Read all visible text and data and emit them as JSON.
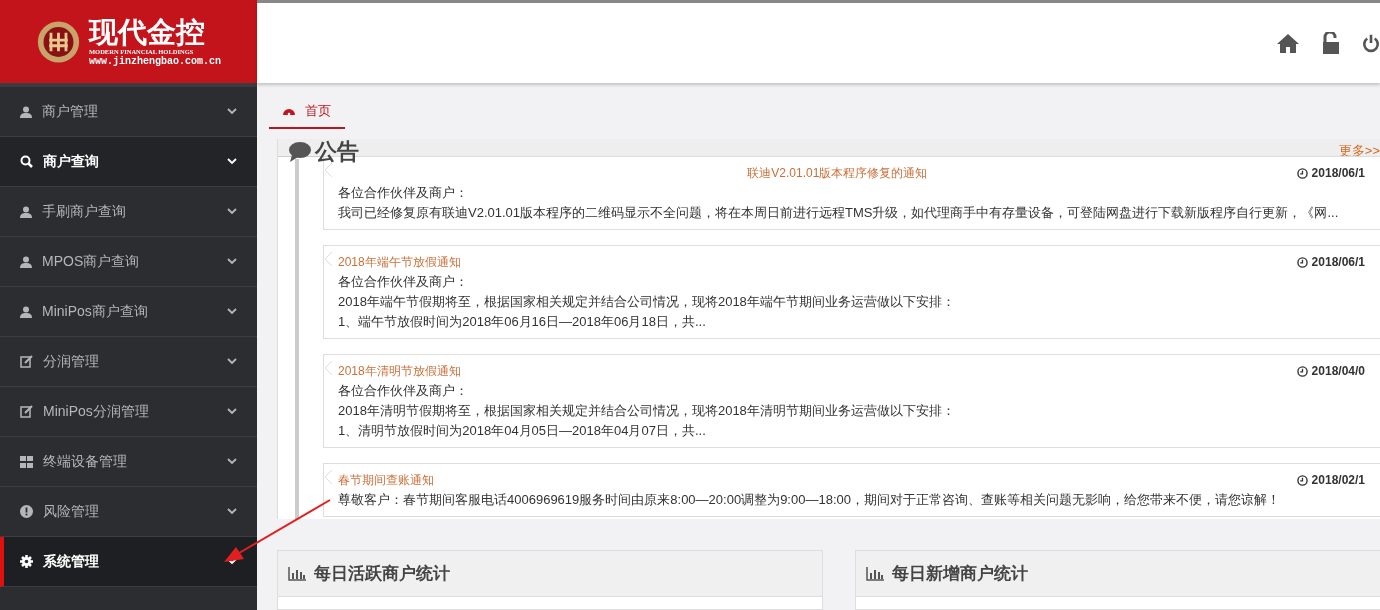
{
  "logo": {
    "title": "现代金控",
    "subtitle": "MODERN FINANCIAL HOLDINGS",
    "url": "www.jinzhengbao.com.cn"
  },
  "sidebar": {
    "items": [
      {
        "label": "商户管理",
        "kind": "user",
        "hovered": false,
        "selected": false
      },
      {
        "label": "商户查询",
        "kind": "search",
        "hovered": true,
        "selected": false
      },
      {
        "label": "手刷商户查询",
        "kind": "user",
        "hovered": false,
        "selected": false
      },
      {
        "label": "MPOS商户查询",
        "kind": "user",
        "hovered": false,
        "selected": false
      },
      {
        "label": "MiniPos商户查询",
        "kind": "user",
        "hovered": false,
        "selected": false
      },
      {
        "label": "分润管理",
        "kind": "edit",
        "hovered": false,
        "selected": false
      },
      {
        "label": "MiniPos分润管理",
        "kind": "edit",
        "hovered": false,
        "selected": false
      },
      {
        "label": "终端设备管理",
        "kind": "grid",
        "hovered": false,
        "selected": false
      },
      {
        "label": "风险管理",
        "kind": "warning",
        "hovered": false,
        "selected": false
      },
      {
        "label": "系统管理",
        "kind": "gear",
        "hovered": true,
        "selected": true
      }
    ]
  },
  "tabs": [
    {
      "label": "首页",
      "selected": true
    }
  ],
  "notices": {
    "title": "公告",
    "more": "更多>>",
    "items": [
      {
        "title": "联迪V2.01.01版本程序修复的通知",
        "title_centered": true,
        "date": "2018/06/1",
        "lines": [
          "各位合作伙伴及商户：",
          "我司已经修复原有联迪V2.01.01版本程序的二维码显示不全问题，将在本周日前进行远程TMS升级，如代理商手中有存量设备，可登陆网盘进行下载新版程序自行更新，《网..."
        ]
      },
      {
        "title": "2018年端午节放假通知",
        "title_centered": false,
        "date": "2018/06/1",
        "lines": [
          "各位合作伙伴及商户：",
          "2018年端午节假期将至，根据国家相关规定并结合公司情况，现将2018年端午节期间业务运营做以下安排：",
          "1、端午节放假时间为2018年06月16日—2018年06月18日，共..."
        ]
      },
      {
        "title": "2018年清明节放假通知",
        "title_centered": false,
        "date": "2018/04/0",
        "lines": [
          "各位合作伙伴及商户：",
          "2018年清明节假期将至，根据国家相关规定并结合公司情况，现将2018年清明节期间业务运营做以下安排：",
          "1、清明节放假时间为2018年04月05日—2018年04月07日，共..."
        ]
      },
      {
        "title": "春节期间查账通知",
        "title_centered": false,
        "date": "2018/02/1",
        "lines": [
          "尊敬客户：春节期间客服电话4006969619服务时间由原来8:00—20:00调整为9:00—18:00，期间对于正常咨询、查账等相关问题无影响，给您带来不便，请您谅解！"
        ]
      }
    ]
  },
  "stats_panels": [
    {
      "title": "每日活跃商户统计"
    },
    {
      "title": "每日新增商户统计"
    }
  ]
}
